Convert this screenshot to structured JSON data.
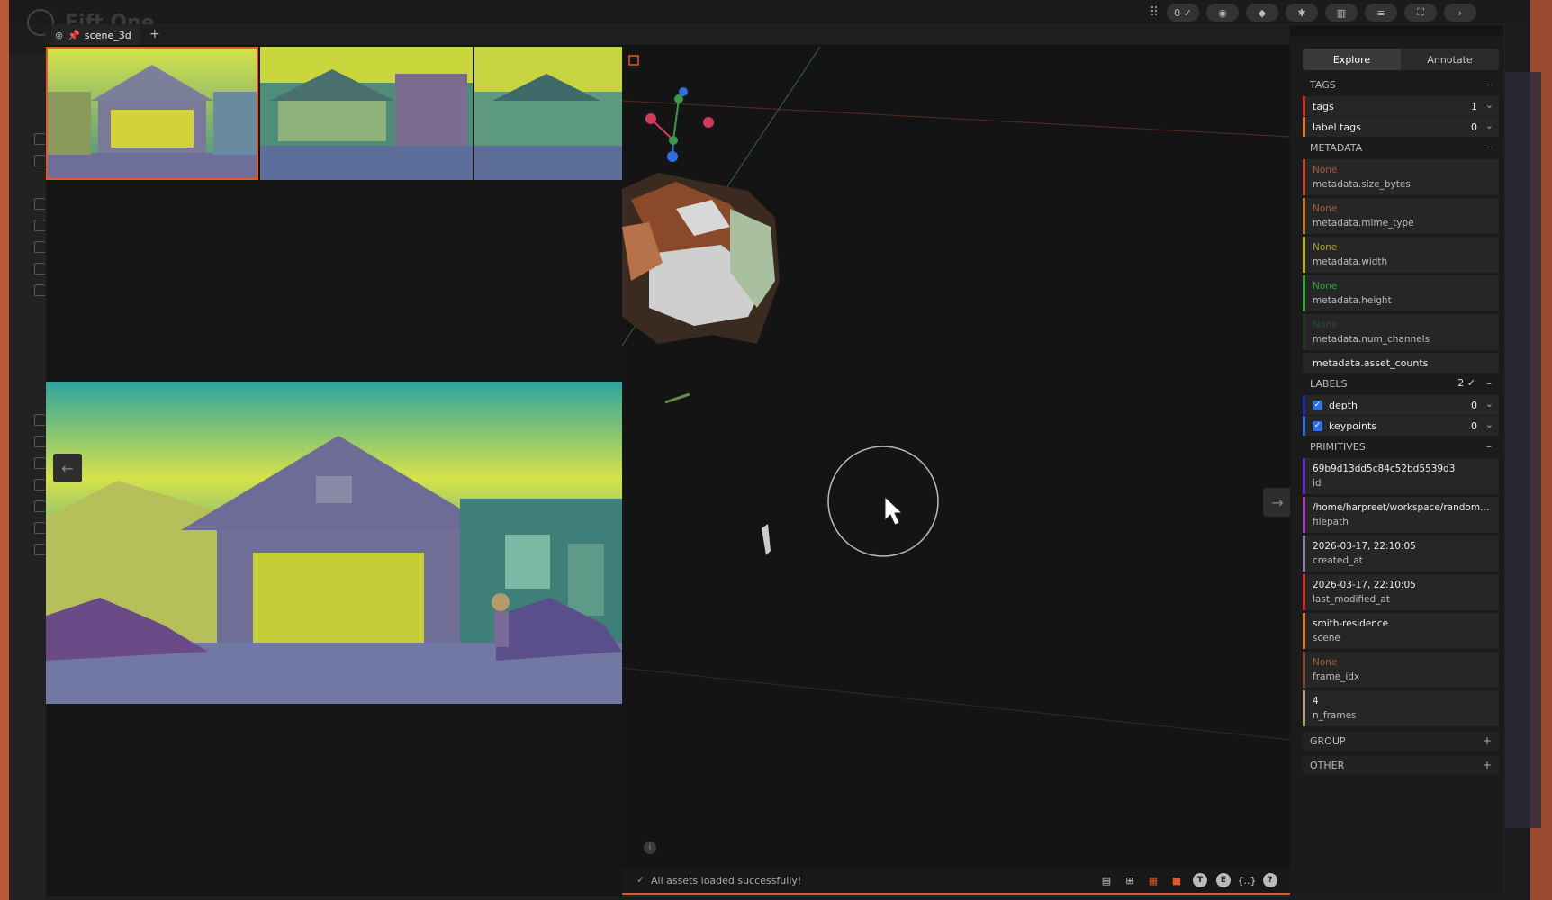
{
  "app": {
    "title": "Fift One"
  },
  "toolbar": {
    "count_pill": "0 ✓"
  },
  "modal": {
    "tab": {
      "label": "scene_3d",
      "add": "+"
    }
  },
  "viewer": {
    "status": "All assets loaded successfully!",
    "status_icons": [
      "chat-icon",
      "hierarchy-icon",
      "grid-icon",
      "camera-icon",
      "T",
      "E",
      "{..}",
      "?"
    ]
  },
  "sidebar": {
    "tabs": {
      "explore": "Explore",
      "annotate": "Annotate"
    },
    "tags": {
      "header": "TAGS",
      "items": [
        {
          "label": "tags",
          "count": "1",
          "color": "#d62b2b"
        },
        {
          "label": "label tags",
          "count": "0",
          "color": "#e07a2b"
        }
      ]
    },
    "metadata": {
      "header": "METADATA",
      "items": [
        {
          "value": "None",
          "key": "metadata.size_bytes",
          "color": "#c0452b"
        },
        {
          "value": "None",
          "key": "metadata.mime_type",
          "color": "#c2762b"
        },
        {
          "value": "None",
          "key": "metadata.width",
          "color": "#b3b22a"
        },
        {
          "value": "None",
          "key": "metadata.height",
          "color": "#35a338"
        },
        {
          "value": "None",
          "key": "metadata.num_channels",
          "color": "#1f3a1f"
        }
      ],
      "extra": "metadata.asset_counts"
    },
    "labels": {
      "header": "LABELS",
      "count": "2 ✓",
      "items": [
        {
          "label": "depth",
          "count": "0",
          "color": "#1d2fb0"
        },
        {
          "label": "keypoints",
          "count": "0",
          "color": "#2f6fe0"
        }
      ]
    },
    "primitives": {
      "header": "PRIMITIVES",
      "items": [
        {
          "value": "69b9d13dd5c84c52bd5539d3",
          "key": "id",
          "color": "#6a2bd6"
        },
        {
          "value": "/home/harpreet/workspace/random_...",
          "key": "filepath",
          "color": "#a63db8"
        },
        {
          "value": "2026-03-17, 22:10:05",
          "key": "created_at",
          "color": "#8a7fa0"
        },
        {
          "value": "2026-03-17, 22:10:05",
          "key": "last_modified_at",
          "color": "#d62b2b"
        },
        {
          "value": "smith-residence",
          "key": "scene",
          "color": "#e07a2b"
        },
        {
          "value": "None",
          "key": "frame_idx",
          "color": "#7a4a2b"
        },
        {
          "value": "4",
          "key": "n_frames",
          "color": "#b0a080"
        }
      ]
    },
    "group": {
      "header": "GROUP",
      "ctl": "+"
    },
    "other": {
      "header": "OTHER",
      "ctl": "+"
    },
    "collapse": "–"
  }
}
